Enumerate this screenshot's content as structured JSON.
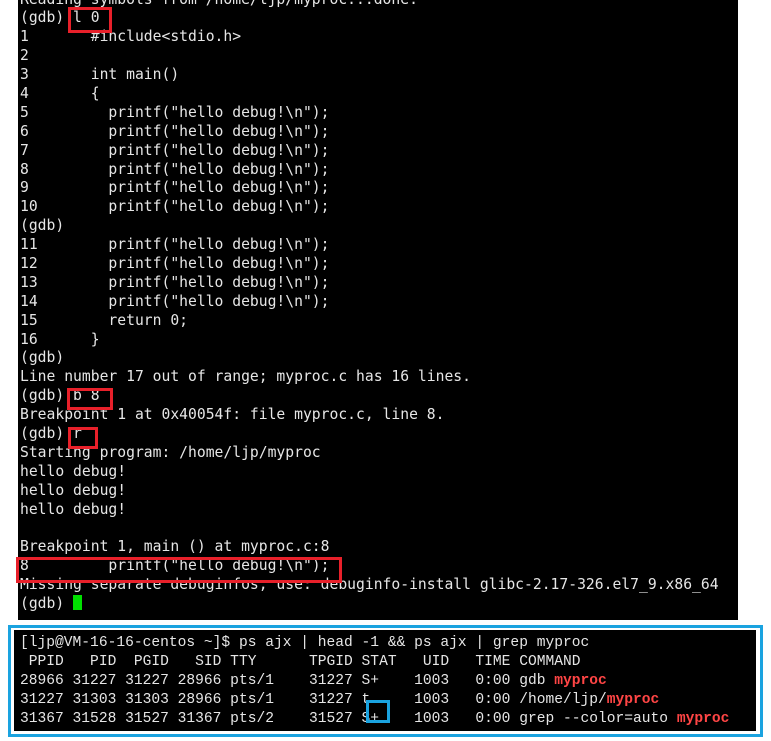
{
  "gdb_terminal": {
    "lines": [
      "Reading symbols from /home/ljp/myproc...done.",
      "(gdb) l 0",
      "1       #include<stdio.h>",
      "2",
      "3       int main()",
      "4       {",
      "5         printf(\"hello debug!\\n\");",
      "6         printf(\"hello debug!\\n\");",
      "7         printf(\"hello debug!\\n\");",
      "8         printf(\"hello debug!\\n\");",
      "9         printf(\"hello debug!\\n\");",
      "10        printf(\"hello debug!\\n\");",
      "(gdb) ",
      "11        printf(\"hello debug!\\n\");",
      "12        printf(\"hello debug!\\n\");",
      "13        printf(\"hello debug!\\n\");",
      "14        printf(\"hello debug!\\n\");",
      "15        return 0;",
      "16      }",
      "(gdb) ",
      "Line number 17 out of range; myproc.c has 16 lines.",
      "(gdb) b 8",
      "Breakpoint 1 at 0x40054f: file myproc.c, line 8.",
      "(gdb) r",
      "Starting program: /home/ljp/myproc",
      "hello debug!",
      "hello debug!",
      "hello debug!",
      "",
      "Breakpoint 1, main () at myproc.c:8",
      "8         printf(\"hello debug!\\n\");",
      "Missing separate debuginfos, use: debuginfo-install glibc-2.17-326.el7_9.x86_64",
      "(gdb) "
    ],
    "cursor_color": "#00e000",
    "highlight_color": "#e8202a"
  },
  "ps_terminal": {
    "prompt_line": "[ljp@VM-16-16-centos ~]$ ps ajx | head -1 && ps ajx | grep myproc",
    "header": " PPID   PID  PGID   SID TTY      TPGID STAT   UID   TIME COMMAND",
    "rows": [
      {
        "text": "28966 31227 31227 28966 pts/1    31227 S+    1003   0:00 gdb ",
        "match": "myproc"
      },
      {
        "text": "31227 31303 31303 28966 pts/1    31227 t     1003   0:00 /home/ljp/",
        "match": "myproc"
      },
      {
        "text": "31367 31528 31527 31367 pts/2    31527 S+    1003   0:00 grep --color=auto ",
        "match": "myproc"
      }
    ],
    "match_color": "#ff4545",
    "frame_color": "#1aa3e0"
  }
}
